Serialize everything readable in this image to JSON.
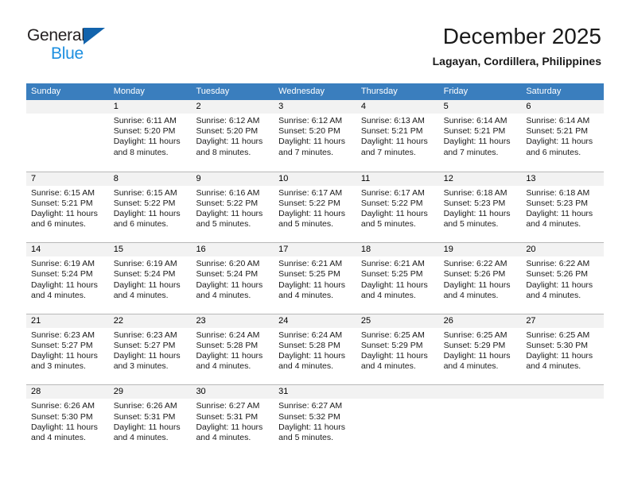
{
  "brand": {
    "name_primary": "General",
    "name_secondary": "Blue",
    "accent_color": "#1263ac",
    "secondary_color": "#1d8fe0"
  },
  "header": {
    "title": "December 2025",
    "subtitle": "Lagayan, Cordillera, Philippines"
  },
  "calendar": {
    "header_bg": "#3a7ebe",
    "daynum_bg": "#f2f2f2",
    "weekdays": [
      "Sunday",
      "Monday",
      "Tuesday",
      "Wednesday",
      "Thursday",
      "Friday",
      "Saturday"
    ],
    "weeks": [
      [
        {
          "day": "",
          "lines": []
        },
        {
          "day": "1",
          "lines": [
            "Sunrise: 6:11 AM",
            "Sunset: 5:20 PM",
            "Daylight: 11 hours",
            "and 8 minutes."
          ]
        },
        {
          "day": "2",
          "lines": [
            "Sunrise: 6:12 AM",
            "Sunset: 5:20 PM",
            "Daylight: 11 hours",
            "and 8 minutes."
          ]
        },
        {
          "day": "3",
          "lines": [
            "Sunrise: 6:12 AM",
            "Sunset: 5:20 PM",
            "Daylight: 11 hours",
            "and 7 minutes."
          ]
        },
        {
          "day": "4",
          "lines": [
            "Sunrise: 6:13 AM",
            "Sunset: 5:21 PM",
            "Daylight: 11 hours",
            "and 7 minutes."
          ]
        },
        {
          "day": "5",
          "lines": [
            "Sunrise: 6:14 AM",
            "Sunset: 5:21 PM",
            "Daylight: 11 hours",
            "and 7 minutes."
          ]
        },
        {
          "day": "6",
          "lines": [
            "Sunrise: 6:14 AM",
            "Sunset: 5:21 PM",
            "Daylight: 11 hours",
            "and 6 minutes."
          ]
        }
      ],
      [
        {
          "day": "7",
          "lines": [
            "Sunrise: 6:15 AM",
            "Sunset: 5:21 PM",
            "Daylight: 11 hours",
            "and 6 minutes."
          ]
        },
        {
          "day": "8",
          "lines": [
            "Sunrise: 6:15 AM",
            "Sunset: 5:22 PM",
            "Daylight: 11 hours",
            "and 6 minutes."
          ]
        },
        {
          "day": "9",
          "lines": [
            "Sunrise: 6:16 AM",
            "Sunset: 5:22 PM",
            "Daylight: 11 hours",
            "and 5 minutes."
          ]
        },
        {
          "day": "10",
          "lines": [
            "Sunrise: 6:17 AM",
            "Sunset: 5:22 PM",
            "Daylight: 11 hours",
            "and 5 minutes."
          ]
        },
        {
          "day": "11",
          "lines": [
            "Sunrise: 6:17 AM",
            "Sunset: 5:22 PM",
            "Daylight: 11 hours",
            "and 5 minutes."
          ]
        },
        {
          "day": "12",
          "lines": [
            "Sunrise: 6:18 AM",
            "Sunset: 5:23 PM",
            "Daylight: 11 hours",
            "and 5 minutes."
          ]
        },
        {
          "day": "13",
          "lines": [
            "Sunrise: 6:18 AM",
            "Sunset: 5:23 PM",
            "Daylight: 11 hours",
            "and 4 minutes."
          ]
        }
      ],
      [
        {
          "day": "14",
          "lines": [
            "Sunrise: 6:19 AM",
            "Sunset: 5:24 PM",
            "Daylight: 11 hours",
            "and 4 minutes."
          ]
        },
        {
          "day": "15",
          "lines": [
            "Sunrise: 6:19 AM",
            "Sunset: 5:24 PM",
            "Daylight: 11 hours",
            "and 4 minutes."
          ]
        },
        {
          "day": "16",
          "lines": [
            "Sunrise: 6:20 AM",
            "Sunset: 5:24 PM",
            "Daylight: 11 hours",
            "and 4 minutes."
          ]
        },
        {
          "day": "17",
          "lines": [
            "Sunrise: 6:21 AM",
            "Sunset: 5:25 PM",
            "Daylight: 11 hours",
            "and 4 minutes."
          ]
        },
        {
          "day": "18",
          "lines": [
            "Sunrise: 6:21 AM",
            "Sunset: 5:25 PM",
            "Daylight: 11 hours",
            "and 4 minutes."
          ]
        },
        {
          "day": "19",
          "lines": [
            "Sunrise: 6:22 AM",
            "Sunset: 5:26 PM",
            "Daylight: 11 hours",
            "and 4 minutes."
          ]
        },
        {
          "day": "20",
          "lines": [
            "Sunrise: 6:22 AM",
            "Sunset: 5:26 PM",
            "Daylight: 11 hours",
            "and 4 minutes."
          ]
        }
      ],
      [
        {
          "day": "21",
          "lines": [
            "Sunrise: 6:23 AM",
            "Sunset: 5:27 PM",
            "Daylight: 11 hours",
            "and 3 minutes."
          ]
        },
        {
          "day": "22",
          "lines": [
            "Sunrise: 6:23 AM",
            "Sunset: 5:27 PM",
            "Daylight: 11 hours",
            "and 3 minutes."
          ]
        },
        {
          "day": "23",
          "lines": [
            "Sunrise: 6:24 AM",
            "Sunset: 5:28 PM",
            "Daylight: 11 hours",
            "and 4 minutes."
          ]
        },
        {
          "day": "24",
          "lines": [
            "Sunrise: 6:24 AM",
            "Sunset: 5:28 PM",
            "Daylight: 11 hours",
            "and 4 minutes."
          ]
        },
        {
          "day": "25",
          "lines": [
            "Sunrise: 6:25 AM",
            "Sunset: 5:29 PM",
            "Daylight: 11 hours",
            "and 4 minutes."
          ]
        },
        {
          "day": "26",
          "lines": [
            "Sunrise: 6:25 AM",
            "Sunset: 5:29 PM",
            "Daylight: 11 hours",
            "and 4 minutes."
          ]
        },
        {
          "day": "27",
          "lines": [
            "Sunrise: 6:25 AM",
            "Sunset: 5:30 PM",
            "Daylight: 11 hours",
            "and 4 minutes."
          ]
        }
      ],
      [
        {
          "day": "28",
          "lines": [
            "Sunrise: 6:26 AM",
            "Sunset: 5:30 PM",
            "Daylight: 11 hours",
            "and 4 minutes."
          ]
        },
        {
          "day": "29",
          "lines": [
            "Sunrise: 6:26 AM",
            "Sunset: 5:31 PM",
            "Daylight: 11 hours",
            "and 4 minutes."
          ]
        },
        {
          "day": "30",
          "lines": [
            "Sunrise: 6:27 AM",
            "Sunset: 5:31 PM",
            "Daylight: 11 hours",
            "and 4 minutes."
          ]
        },
        {
          "day": "31",
          "lines": [
            "Sunrise: 6:27 AM",
            "Sunset: 5:32 PM",
            "Daylight: 11 hours",
            "and 5 minutes."
          ]
        },
        {
          "day": "",
          "lines": []
        },
        {
          "day": "",
          "lines": []
        },
        {
          "day": "",
          "lines": []
        }
      ]
    ]
  }
}
